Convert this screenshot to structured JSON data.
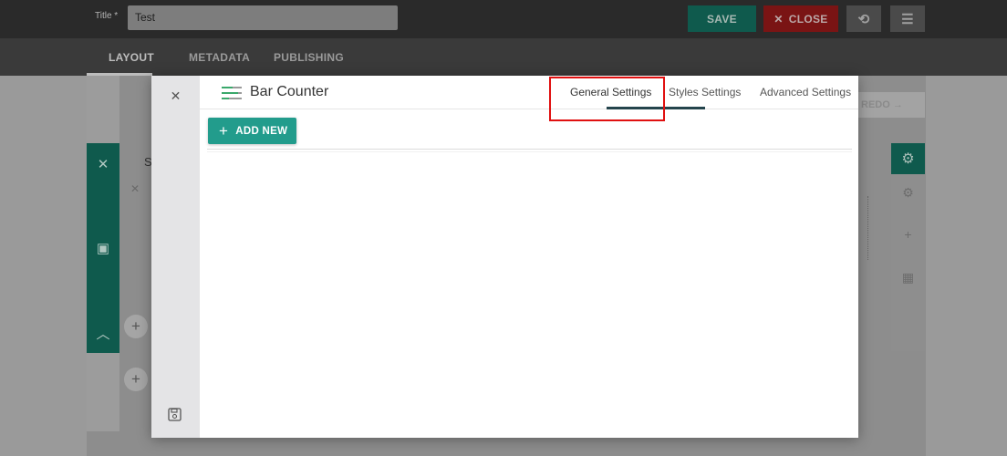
{
  "header": {
    "title_label": "Title *",
    "title_value": "Test",
    "save_label": "SAVE",
    "close_label": "CLOSE"
  },
  "editor_tabs": [
    "LAYOUT",
    "METADATA",
    "PUBLISHING"
  ],
  "background": {
    "redo_label": "REDO",
    "section_letter": "S"
  },
  "modal": {
    "widget_title": "Bar Counter",
    "tabs": [
      {
        "label": "General Settings",
        "active": true
      },
      {
        "label": "Styles Settings",
        "active": false
      },
      {
        "label": "Advanced Settings",
        "active": false
      }
    ],
    "add_new_label": "ADD NEW"
  },
  "colors": {
    "accent_teal": "#229c8c",
    "tab_underline": "#24444c",
    "highlight": "#e01010"
  }
}
